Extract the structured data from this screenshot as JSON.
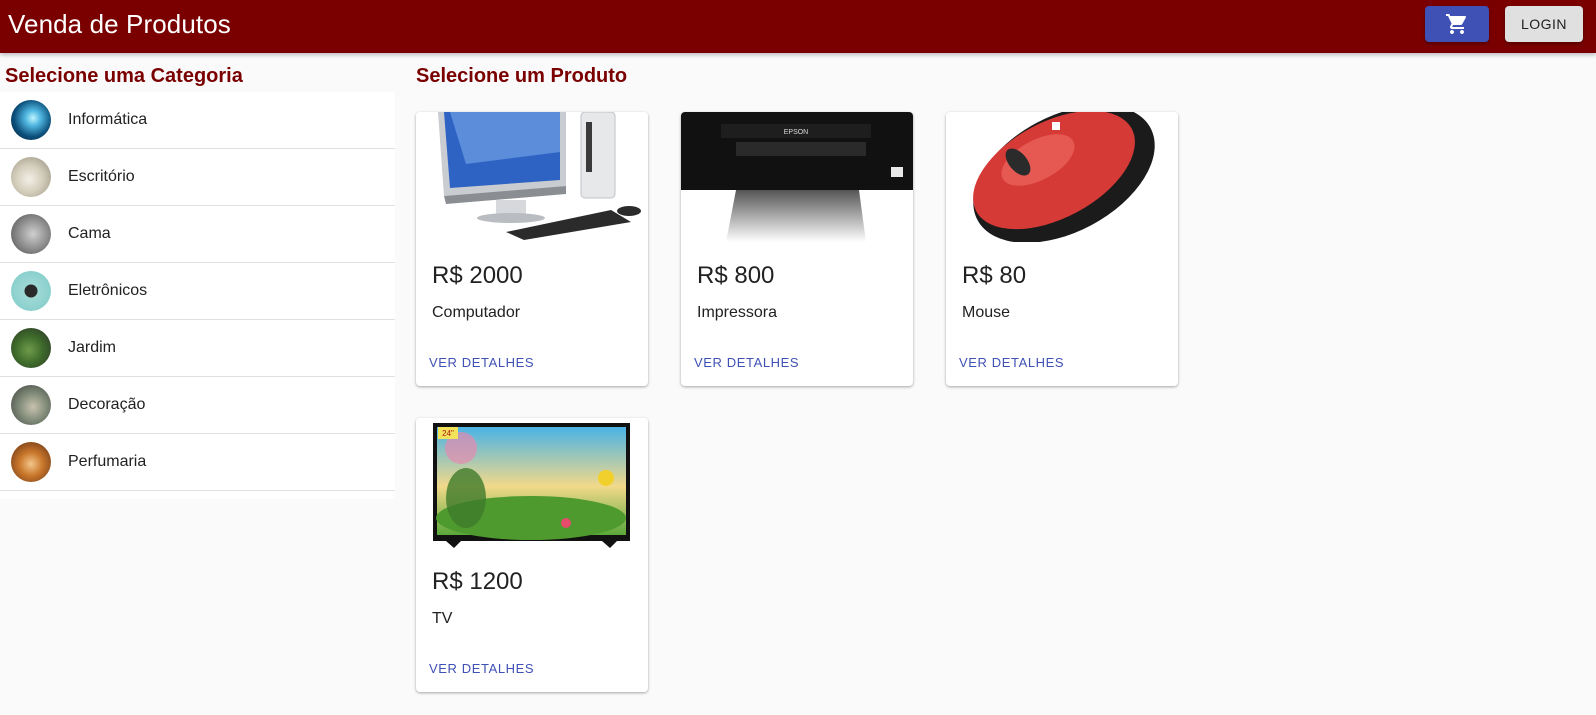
{
  "header": {
    "title": "Venda de Produtos",
    "cart_icon": "shopping-cart-icon",
    "login_label": "LOGIN"
  },
  "colors": {
    "brand": "#7a0000",
    "accent": "#3f51b5"
  },
  "sidebar": {
    "title": "Selecione uma Categoria",
    "items": [
      {
        "label": "Informática"
      },
      {
        "label": "Escritório"
      },
      {
        "label": "Cama"
      },
      {
        "label": "Eletrônicos"
      },
      {
        "label": "Jardim"
      },
      {
        "label": "Decoração"
      },
      {
        "label": "Perfumaria"
      }
    ]
  },
  "main": {
    "title": "Selecione um Produto",
    "products": [
      {
        "price": "R$ 2000",
        "name": "Computador",
        "action": "VER DETALHES"
      },
      {
        "price": "R$ 800",
        "name": "Impressora",
        "action": "VER DETALHES"
      },
      {
        "price": "R$ 80",
        "name": "Mouse",
        "action": "VER DETALHES"
      },
      {
        "price": "R$ 1200",
        "name": "TV",
        "action": "VER DETALHES"
      }
    ]
  }
}
